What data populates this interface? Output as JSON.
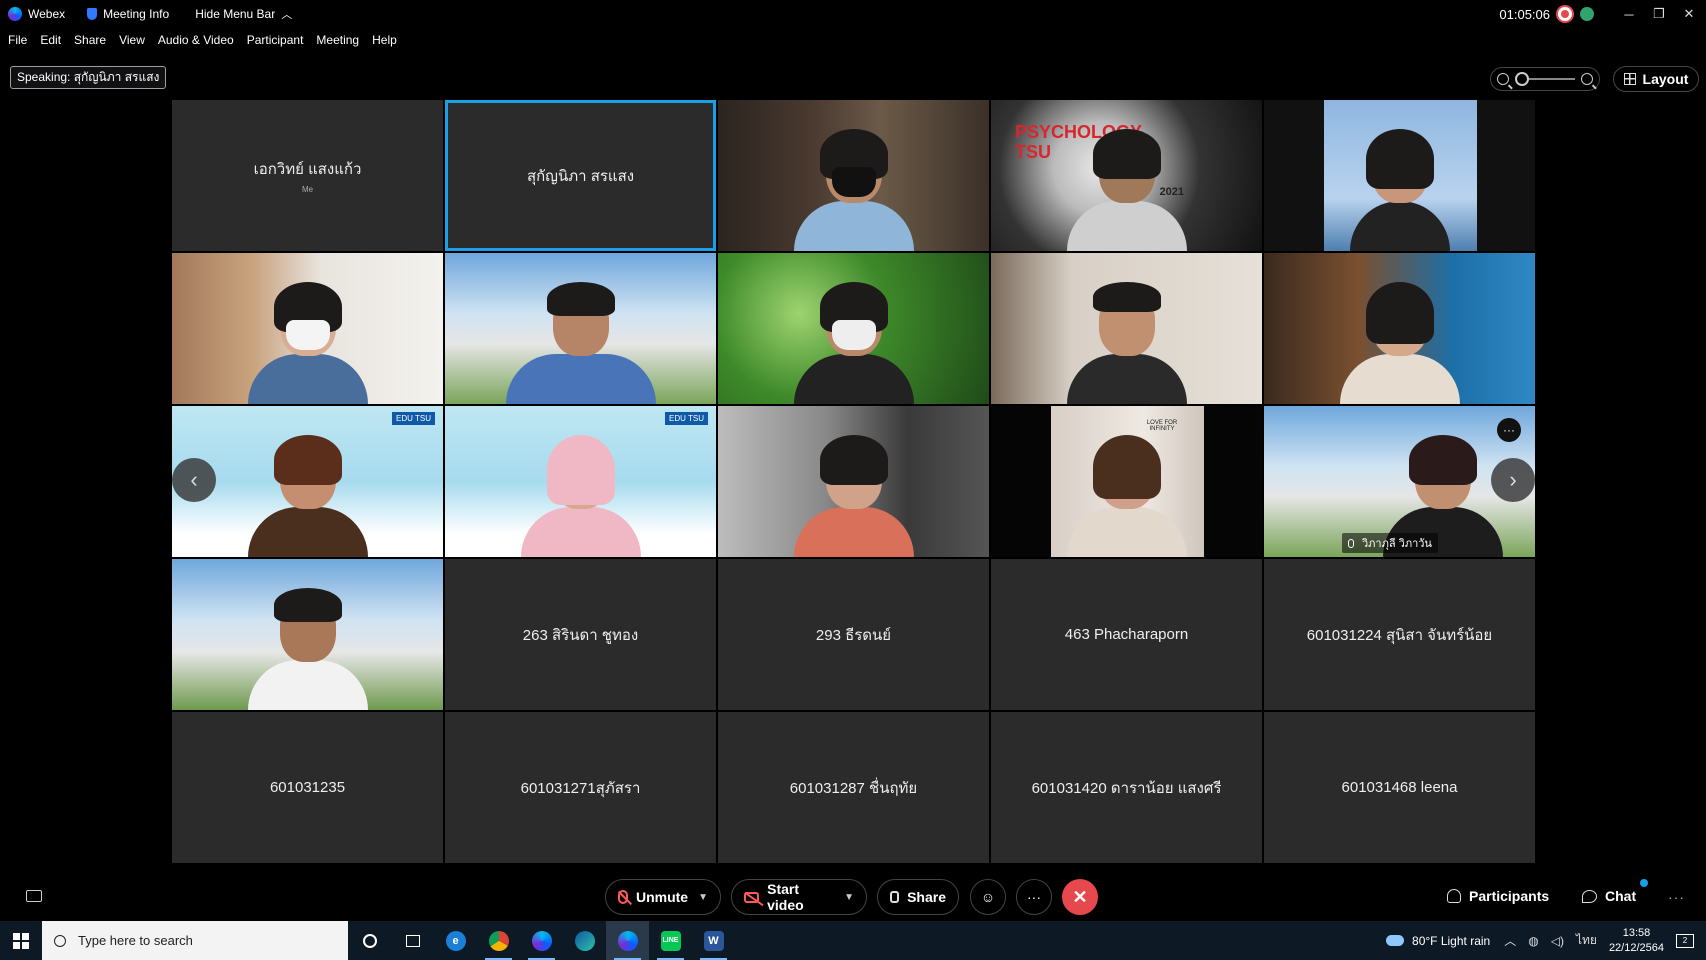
{
  "titlebar": {
    "app_name": "Webex",
    "meeting_info": "Meeting Info",
    "hide_menu_bar": "Hide Menu Bar",
    "timer": "01:05:06"
  },
  "menu": [
    "File",
    "Edit",
    "Share",
    "View",
    "Audio & Video",
    "Participant",
    "Meeting",
    "Help"
  ],
  "speaking_label": "Speaking: สุกัญนิภา สรแสง",
  "layout_button": "Layout",
  "tiles": [
    {
      "name": "เอกวิทย์ แสงแก้ว",
      "sub": "Me"
    },
    {
      "name": "สุกัญนิภา สรแสง"
    },
    {
      "name": ""
    },
    {
      "name": ""
    },
    {
      "name": ""
    },
    {
      "name": ""
    },
    {
      "name": ""
    },
    {
      "name": ""
    },
    {
      "name": ""
    },
    {
      "name": ""
    },
    {
      "name": ""
    },
    {
      "name": ""
    },
    {
      "name": ""
    },
    {
      "name": ""
    },
    {
      "name": "",
      "label": "วิภาภุลี วิภาวัน"
    },
    {
      "name": ""
    },
    {
      "name": "263 สิรินดา ชูทอง"
    },
    {
      "name": "293 ธีรดนย์"
    },
    {
      "name": "463 Phacharaporn"
    },
    {
      "name": "601031224 สุนิสา จันทร์น้อย"
    },
    {
      "name": "601031235"
    },
    {
      "name": "601031271สุภัสรา"
    },
    {
      "name": "601031287 ชื่นฤทัย"
    },
    {
      "name": "601031420 ดาราน้อย แสงศรี"
    },
    {
      "name": "601031468 leena"
    }
  ],
  "tile_text": {
    "edu_tsu": "EDU TSU",
    "psychology": "PSYCHOLOGY",
    "tsu": "TSU",
    "year": "2021",
    "love_for_infinity": "LOVE FOR INFINITY"
  },
  "controls": {
    "unmute": "Unmute",
    "start_video": "Start video",
    "share": "Share",
    "participants": "Participants",
    "chat": "Chat"
  },
  "taskbar": {
    "search_placeholder": "Type here to search",
    "weather": "80°F  Light rain",
    "lang": "ไทย",
    "time": "13:58",
    "date": "22/12/2564",
    "notifications": "2"
  },
  "colors": {
    "active_speaker": "#1aa0e6",
    "end_call": "#e5484d",
    "muted": "#ff5a5a"
  }
}
